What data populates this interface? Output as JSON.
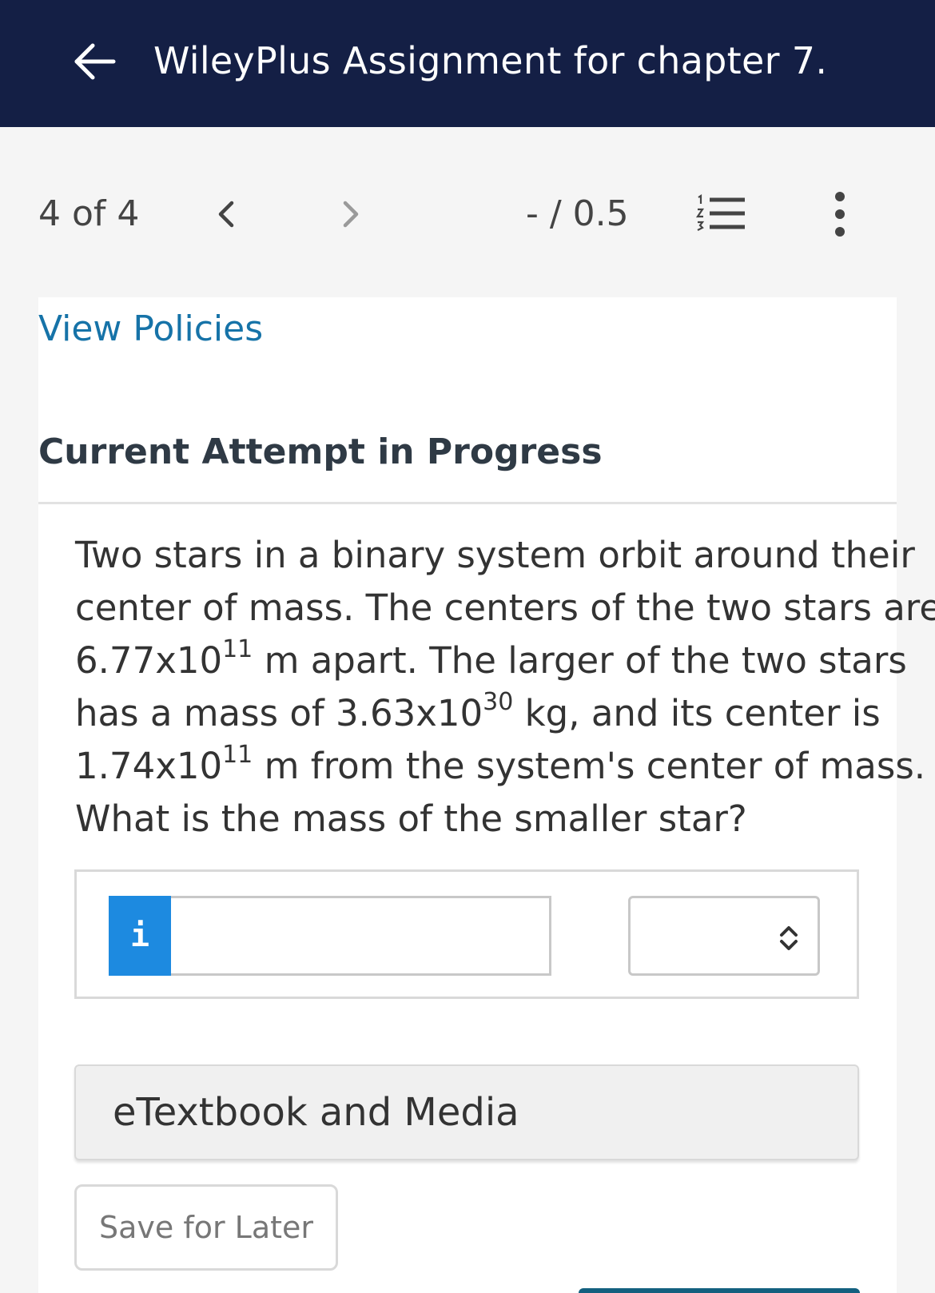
{
  "header": {
    "title": "WileyPlus Assignment for chapter 7."
  },
  "nav": {
    "counter": "4 of 4",
    "score": "- / 0.5"
  },
  "content": {
    "view_policies": "View Policies",
    "attempt_heading": "Current Attempt in Progress",
    "question": {
      "line1": "Two stars in a binary system orbit around their",
      "line2": "center of mass. The centers of the two stars are",
      "line3_base": "6.77x10",
      "line3_exp": "11",
      "line3_rest": " m apart. The larger of the two stars",
      "line4_pre": "has a mass of 3.63x10",
      "line4_exp": "30",
      "line4_rest": " kg, and its center is",
      "line5_base": "1.74x10",
      "line5_exp": "11",
      "line5_rest": " m from the system's center of mass.",
      "line6": "What is the mass of the smaller star?"
    },
    "answer": {
      "info_label": "i",
      "value": "",
      "unit_selected": ""
    },
    "etextbook_label": "eTextbook and Media",
    "save_later_label": "Save for Later"
  },
  "icons": {
    "back": "arrow-left-icon",
    "prev": "chevron-left-icon",
    "next": "chevron-right-icon",
    "list": "numbered-list-icon",
    "more": "vertical-dots-icon",
    "select": "chevron-up-down-icon"
  },
  "colors": {
    "header_bg": "#141f45",
    "link": "#1673a8",
    "info_button": "#1d8ae0"
  }
}
